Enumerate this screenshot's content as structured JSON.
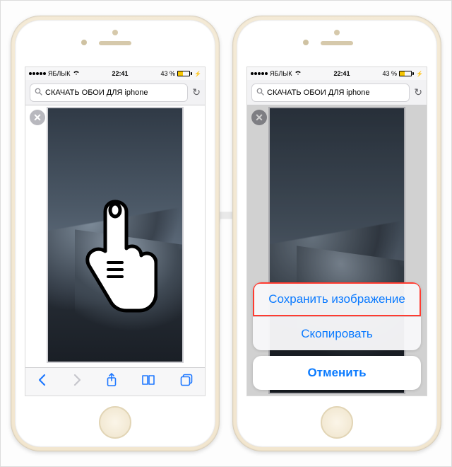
{
  "watermark": "Яблык",
  "status": {
    "carrier": "ЯБЛЫК",
    "time": "22:41",
    "battery_text": "43 %",
    "battery_pct": 43
  },
  "search": {
    "query": "СКАЧАТЬ ОБОИ ДЛЯ iphone"
  },
  "actionsheet": {
    "save_image": "Сохранить изображение",
    "copy": "Скопировать",
    "cancel": "Отменить"
  },
  "icons": {
    "search": "search-icon",
    "reload": "reload-icon",
    "close": "close-icon",
    "back": "back-icon",
    "forward": "forward-icon",
    "share": "share-icon",
    "bookmarks": "bookmarks-icon",
    "tabs": "tabs-icon",
    "wifi": "wifi-icon",
    "charging": "charging-icon"
  }
}
